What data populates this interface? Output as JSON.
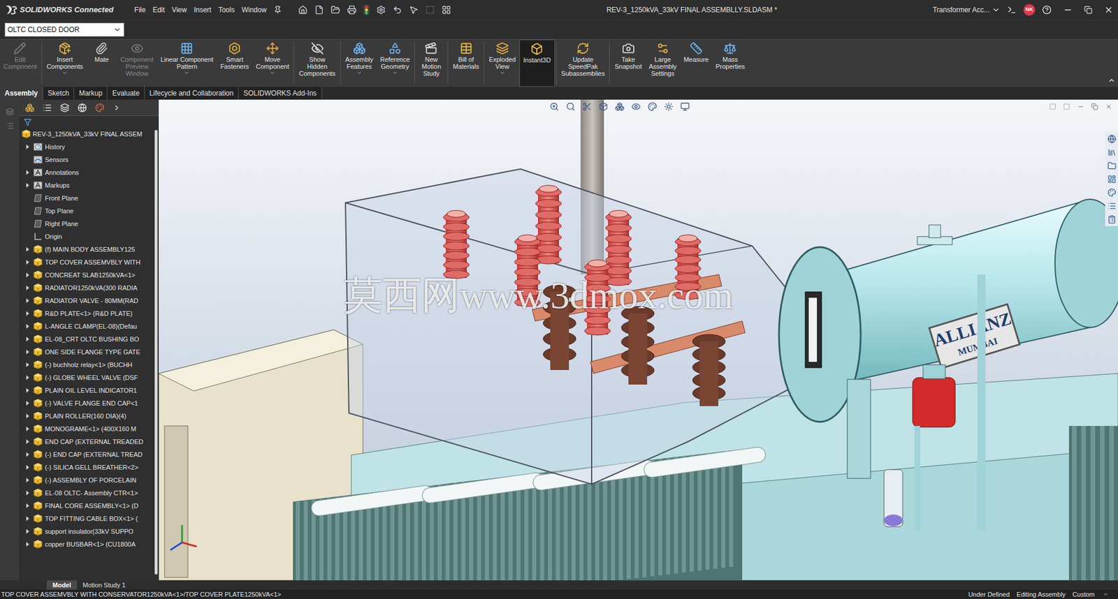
{
  "window": {
    "app": "SOLIDWORKS Connected",
    "title": "REV-3_1250kVA_33kV FINAL ASSEMBLLY.SLDASM *",
    "account": "Transformer Acc...",
    "user_initials": "NK"
  },
  "menu": [
    "File",
    "Edit",
    "View",
    "Insert",
    "Tools",
    "Window"
  ],
  "configuration": {
    "value": "OLTC CLOSED DOOR"
  },
  "ribbon": [
    {
      "lines": [
        "Edit",
        "Component"
      ],
      "disabled": true,
      "selected": false,
      "has_menu": false,
      "separator_after": true
    },
    {
      "lines": [
        "Insert",
        "Components"
      ],
      "disabled": false,
      "selected": false,
      "has_menu": true,
      "separator_after": false
    },
    {
      "lines": [
        "Mate"
      ],
      "disabled": false,
      "selected": false,
      "has_menu": false,
      "separator_after": false
    },
    {
      "lines": [
        "Component",
        "Preview",
        "Window"
      ],
      "disabled": true,
      "selected": false,
      "has_menu": false,
      "separator_after": false
    },
    {
      "lines": [
        "Linear Component",
        "Pattern"
      ],
      "disabled": false,
      "selected": false,
      "has_menu": true,
      "separator_after": false
    },
    {
      "lines": [
        "Smart",
        "Fasteners"
      ],
      "disabled": false,
      "selected": false,
      "has_menu": false,
      "separator_after": false
    },
    {
      "lines": [
        "Move",
        "Component"
      ],
      "disabled": false,
      "selected": false,
      "has_menu": true,
      "separator_after": true
    },
    {
      "lines": [
        "Show",
        "Hidden",
        "Components"
      ],
      "disabled": false,
      "selected": false,
      "has_menu": false,
      "separator_after": true
    },
    {
      "lines": [
        "Assembly",
        "Features"
      ],
      "disabled": false,
      "selected": false,
      "has_menu": true,
      "separator_after": false
    },
    {
      "lines": [
        "Reference",
        "Geometry"
      ],
      "disabled": false,
      "selected": false,
      "has_menu": true,
      "separator_after": true
    },
    {
      "lines": [
        "New",
        "Motion",
        "Study"
      ],
      "disabled": false,
      "selected": false,
      "has_menu": false,
      "separator_after": true
    },
    {
      "lines": [
        "Bill of",
        "Materials"
      ],
      "disabled": false,
      "selected": false,
      "has_menu": false,
      "separator_after": true
    },
    {
      "lines": [
        "Exploded",
        "View"
      ],
      "disabled": false,
      "selected": false,
      "has_menu": true,
      "separator_after": false
    },
    {
      "lines": [
        "Instant3D"
      ],
      "disabled": false,
      "selected": true,
      "has_menu": false,
      "separator_after": true
    },
    {
      "lines": [
        "Update",
        "SpeedPak",
        "Subassemblies"
      ],
      "disabled": false,
      "selected": false,
      "has_menu": false,
      "separator_after": true
    },
    {
      "lines": [
        "Take",
        "Snapshot"
      ],
      "disabled": false,
      "selected": false,
      "has_menu": false,
      "separator_after": false
    },
    {
      "lines": [
        "Large",
        "Assembly",
        "Settings"
      ],
      "disabled": false,
      "selected": false,
      "has_menu": false,
      "separator_after": false
    },
    {
      "lines": [
        "Measure"
      ],
      "disabled": false,
      "selected": false,
      "has_menu": false,
      "separator_after": false
    },
    {
      "lines": [
        "Mass",
        "Properties"
      ],
      "disabled": false,
      "selected": false,
      "has_menu": false,
      "separator_after": false
    }
  ],
  "tabs": [
    {
      "label": "Assembly",
      "selected": true
    },
    {
      "label": "Sketch",
      "selected": false
    },
    {
      "label": "Markup",
      "selected": false
    },
    {
      "label": "Evaluate",
      "selected": false
    },
    {
      "label": "Lifecycle and Collaboration",
      "selected": false
    },
    {
      "label": "SOLIDWORKS Add-Ins",
      "selected": false
    }
  ],
  "feature_tree": {
    "root": "REV-3_1250kVA_33kV FINAL ASSEM",
    "items": [
      {
        "label": "History",
        "kind": "history",
        "expandable": true
      },
      {
        "label": "Sensors",
        "kind": "sensor",
        "expandable": false
      },
      {
        "label": "Annotations",
        "kind": "annotation",
        "expandable": true
      },
      {
        "label": "Markups",
        "kind": "markup",
        "expandable": true
      },
      {
        "label": "Front Plane",
        "kind": "plane",
        "expandable": false
      },
      {
        "label": "Top Plane",
        "kind": "plane",
        "expandable": false
      },
      {
        "label": "Right Plane",
        "kind": "plane",
        "expandable": false
      },
      {
        "label": "Origin",
        "kind": "origin",
        "expandable": false
      },
      {
        "label": "(f) MAIN BODY ASSEMBLY125",
        "kind": "assembly",
        "expandable": true
      },
      {
        "label": "TOP COVER ASSEMVBLY WITH",
        "kind": "assembly",
        "expandable": true
      },
      {
        "label": "CONCREAT SLAB1250kVA<1>",
        "kind": "assembly",
        "expandable": true
      },
      {
        "label": "RADIATOR1250kVA(300 RADIA",
        "kind": "assembly",
        "expandable": true
      },
      {
        "label": "RADIATOR VALVE - 80MM(RAD",
        "kind": "assembly",
        "expandable": true
      },
      {
        "label": "R&D PLATE<1> (R&D PLATE)",
        "kind": "assembly",
        "expandable": true
      },
      {
        "label": "L-ANGLE CLAMP(EL-08)(Defau",
        "kind": "assembly",
        "expandable": true
      },
      {
        "label": "EL-08_CRT OLTC BUSHING BO",
        "kind": "assembly",
        "expandable": true
      },
      {
        "label": "ONE SIDE FLANGE TYPE GATE",
        "kind": "assembly",
        "expandable": true
      },
      {
        "label": "(-) buchholz relay<1> (BUCHH",
        "kind": "assembly",
        "expandable": true
      },
      {
        "label": "(-) GLOBE WHEEL VALVE (DSF",
        "kind": "assembly",
        "expandable": true
      },
      {
        "label": "PLAIN OIL LEVEL INDICATOR1",
        "kind": "assembly",
        "expandable": true
      },
      {
        "label": "(-) VALVE FLANGE END CAP<1",
        "kind": "assembly",
        "expandable": true
      },
      {
        "label": "PLAIN ROLLER(160 DIA)(4)",
        "kind": "assembly",
        "expandable": true
      },
      {
        "label": "MONOGRAME<1> (400X160 M",
        "kind": "assembly",
        "expandable": true
      },
      {
        "label": "END CAP (EXTERNAL TREADED",
        "kind": "assembly",
        "expandable": true
      },
      {
        "label": "(-) END CAP (EXTERNAL TREAD",
        "kind": "assembly",
        "expandable": true
      },
      {
        "label": "(-) SILICA GELL BREATHER<2>",
        "kind": "assembly",
        "expandable": true
      },
      {
        "label": "(-) ASSEMBLY OF PORCELAIN",
        "kind": "assembly",
        "expandable": true
      },
      {
        "label": "EL-08 OLTC- Assembly CTR<1>",
        "kind": "assembly",
        "expandable": true
      },
      {
        "label": "FINAL CORE ASSEMBLY<1> (D",
        "kind": "assembly",
        "expandable": true
      },
      {
        "label": "TOP FITTING CABLE BOX<1> (",
        "kind": "assembly",
        "expandable": true
      },
      {
        "label": "support insulator(33kV SUPPO",
        "kind": "assembly",
        "expandable": true
      },
      {
        "label": "copper BUSBAR<1> (CU1800A",
        "kind": "assembly",
        "expandable": true
      }
    ]
  },
  "viewport": {
    "watermark": "莫西网www.3dmox.com",
    "nameplate": [
      "ALLIANZ",
      "MUMBAI"
    ]
  },
  "bottom_tabs": [
    {
      "label": "Model",
      "selected": true
    },
    {
      "label": "Motion Study 1",
      "selected": false
    }
  ],
  "status_bar": {
    "path": "TOP COVER ASSEMVBLY WITH CONSERVATOR1250kVA<1>/TOP COVER PLATE1250kVA<1>",
    "items": [
      "Under Defined",
      "Editing Assembly",
      "Custom"
    ]
  }
}
